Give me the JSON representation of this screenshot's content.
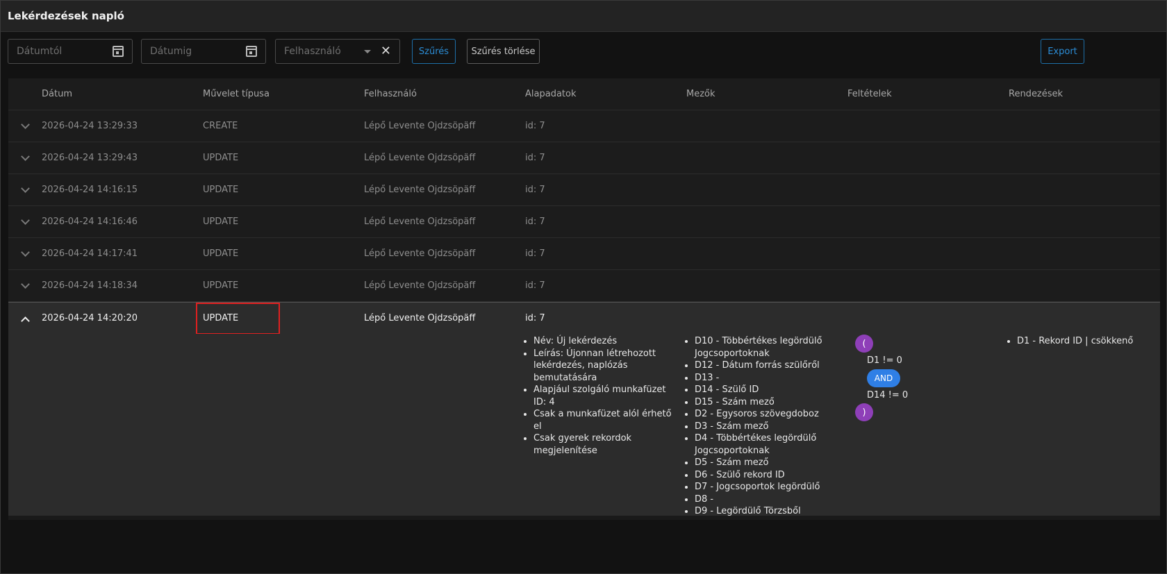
{
  "header": {
    "title": "Lekérdezések napló"
  },
  "filters": {
    "date_from_placeholder": "Dátumtól",
    "date_to_placeholder": "Dátumig",
    "user_placeholder": "Felhasználó",
    "filter_button": "Szűrés",
    "clear_filter_button": "Szűrés törlése",
    "export_button": "Export"
  },
  "table": {
    "columns": [
      "Dátum",
      "Művelet típusa",
      "Felhasználó",
      "Alapadatok",
      "Mezők",
      "Feltételek",
      "Rendezések"
    ],
    "rows": [
      {
        "date": "2026-04-24 13:29:33",
        "type": "CREATE",
        "user": "Lépő Levente Ojdzsöpäff",
        "base": "id: 7"
      },
      {
        "date": "2026-04-24 13:29:43",
        "type": "UPDATE",
        "user": "Lépő Levente Ojdzsöpäff",
        "base": "id: 7"
      },
      {
        "date": "2026-04-24 14:16:15",
        "type": "UPDATE",
        "user": "Lépő Levente Ojdzsöpäff",
        "base": "id: 7"
      },
      {
        "date": "2026-04-24 14:16:46",
        "type": "UPDATE",
        "user": "Lépő Levente Ojdzsöpäff",
        "base": "id: 7"
      },
      {
        "date": "2026-04-24 14:17:41",
        "type": "UPDATE",
        "user": "Lépő Levente Ojdzsöpäff",
        "base": "id: 7"
      },
      {
        "date": "2026-04-24 14:18:34",
        "type": "UPDATE",
        "user": "Lépő Levente Ojdzsöpäff",
        "base": "id: 7"
      },
      {
        "date": "2026-04-24 14:20:20",
        "type": "UPDATE",
        "user": "Lépő Levente Ojdzsöpäff",
        "base": "id: 7"
      }
    ],
    "expanded": {
      "base_items": [
        "Név: Új lekérdezés",
        "Leírás: Újonnan létrehozott lekérdezés, naplózás bemutatására",
        "Alapjául szolgáló munkafüzet ID: 4",
        "Csak a munkafüzet alól érhető el",
        "Csak gyerek rekordok megjelenítése"
      ],
      "fields": [
        "D10 - Többértékes legördülő Jogcsoportoknak",
        "D12 - Dátum forrás szülőről",
        "D13 -",
        "D14 - Szülő ID",
        "D15 - Szám mező",
        "D2 - Egysoros szövegdoboz",
        "D3 - Szám mező",
        "D4 - Többértékes legördülő Jogcsoportoknak",
        "D5 - Szám mező",
        "D6 - Szülő rekord ID",
        "D7 - Jogcsoportok legördülő",
        "D8 -",
        "D9 - Legördülő Törzsből"
      ],
      "conditions": {
        "open_paren": "(",
        "cond1": "D1 != 0",
        "operator": "AND",
        "cond2": "D14 != 0",
        "close_paren": ")"
      },
      "sortings": [
        "D1 - Rekord ID | csökkenő"
      ]
    }
  }
}
